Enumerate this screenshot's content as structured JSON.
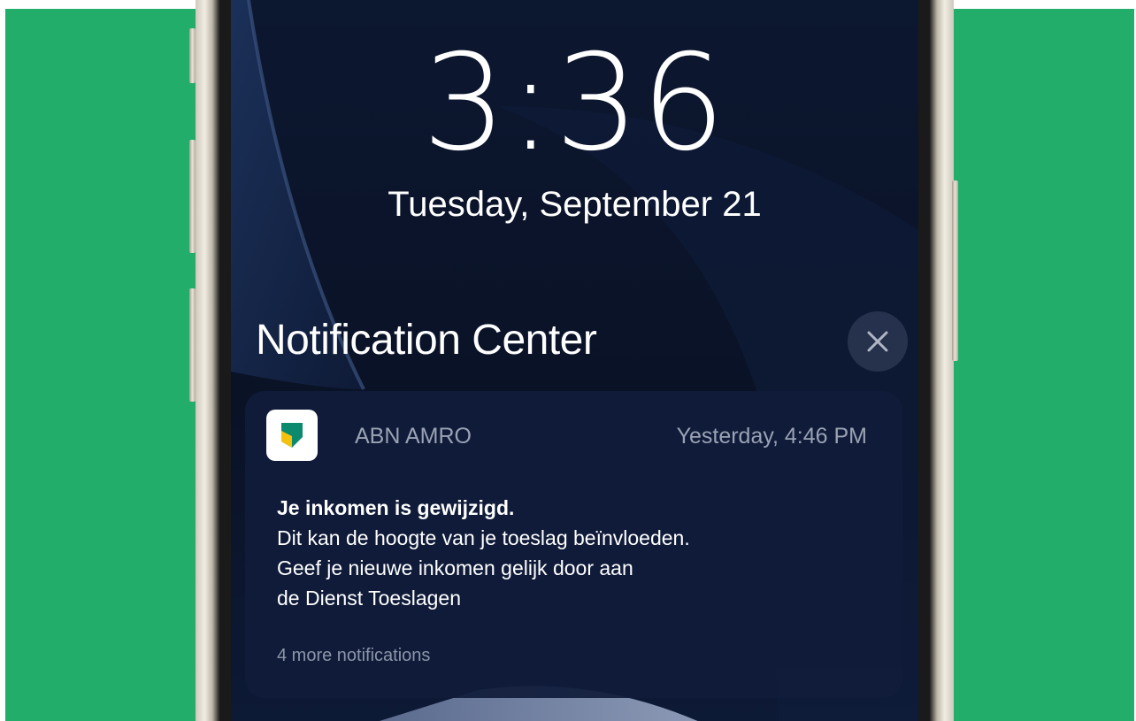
{
  "lockscreen": {
    "time": "3:36",
    "date": "Tuesday, September 21"
  },
  "notification_center": {
    "title": "Notification Center",
    "close_icon": "close-icon"
  },
  "notification": {
    "app_icon": "abn-amro-shield-icon",
    "app_name": "ABN AMRO",
    "timestamp": "Yesterday, 4:46 PM",
    "title": "Je inkomen is gewijzigd.",
    "body_lines": [
      "Dit kan de hoogte van je toeslag beïnvloeden.",
      "Geef je nieuwe inkomen gelijk door aan",
      "de Dienst Toeslagen"
    ],
    "more": "4 more notifications"
  },
  "colors": {
    "background": "#22ad6a",
    "brand_green": "#0b8a6e",
    "brand_yellow": "#f4c20d"
  }
}
